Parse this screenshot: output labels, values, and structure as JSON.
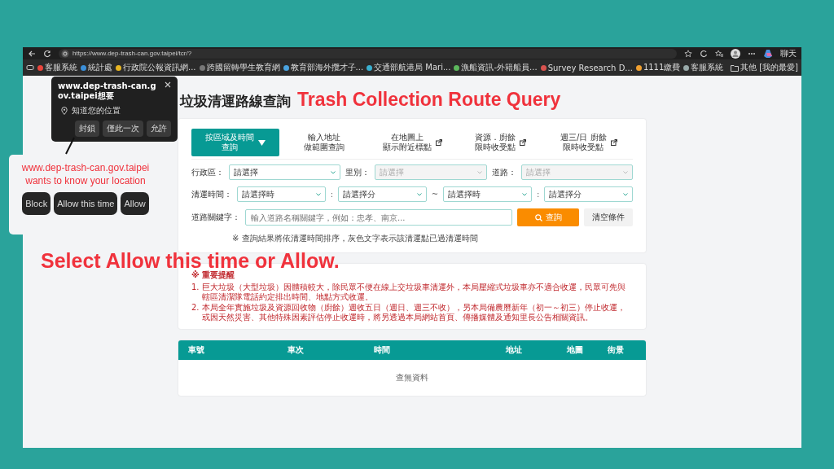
{
  "browser": {
    "url": "https://www.dep-trash-can.gov.taipei/tcr/?",
    "profile_label": "聊天",
    "bookmarks": [
      "客服系統",
      "統計處",
      "行政院公報資訊網...",
      "跨國留轉學生教育網",
      "教育部海外攬才子...",
      "交通部航港局 Mari...",
      "漁船資訊-外籍船員...",
      "Survey Research D...",
      "1111繳費",
      "客服系統"
    ],
    "other_bookmarks": "其他 [我的最愛]"
  },
  "page": {
    "title": "垃圾清運路線查詢",
    "title_en": "Trash Collection Route Query",
    "tabs": [
      {
        "lines": [
          "按區域及時間",
          "查詢"
        ],
        "selected": true,
        "external": false
      },
      {
        "lines": [
          "輸入地址",
          "做範圍查詢"
        ],
        "selected": false,
        "external": false
      },
      {
        "lines": [
          "在地圖上",
          "顯示附近標點"
        ],
        "selected": false,
        "external": true
      },
      {
        "lines": [
          "資源．廚餘",
          "限時收受點"
        ],
        "selected": false,
        "external": true
      },
      {
        "lines": [
          "週三/日 廚餘",
          "限時收受點"
        ],
        "selected": false,
        "external": true
      }
    ],
    "district_row": [
      {
        "label": "行政區：",
        "value": "請選擇",
        "disabled": false
      },
      {
        "label": "里別：",
        "value": "請選擇",
        "disabled": true
      },
      {
        "label": "道路：",
        "value": "請選擇",
        "disabled": true
      }
    ],
    "time_row": {
      "label": "清運時間：",
      "selects": [
        "請選擇時",
        "請選擇分",
        "請選擇時",
        "請選擇分"
      ],
      "separators": [
        ":",
        "~",
        ":"
      ]
    },
    "keyword": {
      "label": "道路關鍵字：",
      "placeholder": "輸入道路名稱關鍵字，例如：忠孝、南京...",
      "search_button": "查詢",
      "clear_button": "清空條件"
    },
    "note": "※ 查詢結果將依清運時間排序，灰色文字表示該清運點已過清運時間",
    "notice": {
      "title": "※ 重要提醒",
      "items": [
        {
          "number": "1.",
          "text": "巨大垃圾（大型垃圾）因體積較大，除民眾不便在線上交垃圾車清運外，本局壓縮式垃圾車亦不適合收運，民眾可先與轄區清潔隊電話約定排出時間、地點方式收運。"
        },
        {
          "number": "2.",
          "text": "本局全年實施垃圾及資源回收物（廚餘）週收五日（週日、週三不收），另本局備農曆新年（初一～初三）停止收運，或因天然災害、其他特殊因素評估停止收運時，將另透過本局網站首頁、傳播媒體及通知里長公告相關資訊。"
        }
      ]
    },
    "table": {
      "columns": [
        "車號",
        "車次",
        "時間",
        "地址",
        "地圖",
        "街景"
      ],
      "empty": "查無資料"
    }
  },
  "prompt": {
    "site": "www.dep-trash-can.gov.taipei想要",
    "permission": "知道您的位置",
    "buttons": [
      "封鎖",
      "僅此一次",
      "允許"
    ]
  },
  "callout": {
    "lines": [
      "www.dep-trash-can.gov.taipei",
      "wants to know your location"
    ],
    "buttons": [
      "Block",
      "Allow this time",
      "Allow"
    ]
  },
  "instruction": "Select Allow this time or Allow."
}
